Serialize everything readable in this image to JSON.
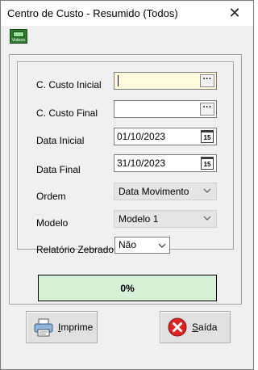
{
  "window": {
    "title": "Centro de Custo - Resumido (Todos)",
    "close_label": "✕"
  },
  "toolbar": {
    "video_label": "Videos"
  },
  "form": {
    "custo_inicial_label": "C. Custo Inicial",
    "custo_inicial_value": "",
    "custo_final_label": "C. Custo Final",
    "custo_final_value": "",
    "data_inicial_label": "Data Inicial",
    "data_inicial_value": "01/10/2023",
    "data_final_label": "Data Final",
    "data_final_value": "31/10/2023",
    "ordem_label": "Ordem",
    "ordem_value": "Data Movimento",
    "modelo_label": "Modelo",
    "modelo_value": "Modelo 1",
    "zebrado_label": "Relatório Zebrado",
    "zebrado_value": "Não",
    "ellipsis": "···",
    "cal_icon_text": "15"
  },
  "progress": {
    "text": "0%",
    "value": 0
  },
  "buttons": {
    "imprime_first": "I",
    "imprime_rest": "mprime",
    "saida_first": "S",
    "saida_rest": "aída"
  },
  "colors": {
    "focused_field": "#fffbdc",
    "progress_fill": "#d7f0d8",
    "close_icon_red": "#d92323"
  }
}
